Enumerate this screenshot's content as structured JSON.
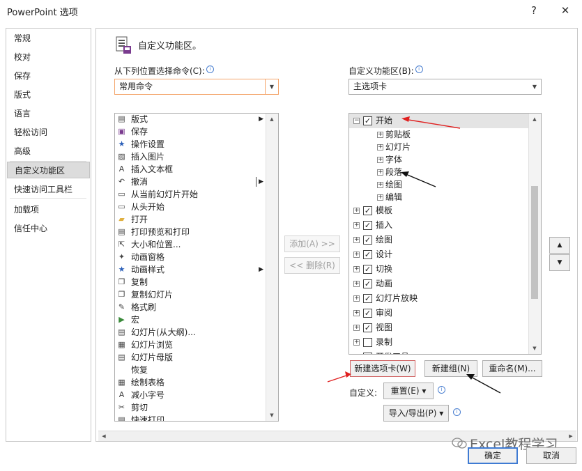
{
  "window": {
    "title": "PowerPoint 选项",
    "help_label": "?",
    "close_label": "✕"
  },
  "nav": {
    "items": [
      "常规",
      "校对",
      "保存",
      "版式",
      "语言",
      "轻松访问",
      "高级",
      "自定义功能区",
      "快速访问工具栏",
      "加载项",
      "信任中心"
    ],
    "selected_index": 7
  },
  "header": {
    "icon": "customize-ribbon-icon",
    "title": "自定义功能区。"
  },
  "left": {
    "label": "从下列位置选择命令(C):",
    "info": "ⓘ",
    "dropdown_value": "常用命令",
    "commands": [
      {
        "label": "版式",
        "icon": "layout-icon",
        "submenu": true
      },
      {
        "label": "保存",
        "icon": "save-icon"
      },
      {
        "label": "操作设置",
        "icon": "star-icon"
      },
      {
        "label": "插入图片",
        "icon": "picture-icon"
      },
      {
        "label": "插入文本框",
        "icon": "textbox-icon"
      },
      {
        "label": "撤消",
        "icon": "undo-icon",
        "submenu": true
      },
      {
        "label": "从当前幻灯片开始",
        "icon": "slideshow-icon"
      },
      {
        "label": "从头开始",
        "icon": "slideshow-start-icon"
      },
      {
        "label": "打开",
        "icon": "folder-icon"
      },
      {
        "label": "打印预览和打印",
        "icon": "print-preview-icon"
      },
      {
        "label": "大小和位置...",
        "icon": "size-icon"
      },
      {
        "label": "动画窗格",
        "icon": "animation-pane-icon"
      },
      {
        "label": "动画样式",
        "icon": "star-icon",
        "submenu": true
      },
      {
        "label": "复制",
        "icon": "copy-icon"
      },
      {
        "label": "复制幻灯片",
        "icon": "duplicate-icon"
      },
      {
        "label": "格式刷",
        "icon": "format-painter-icon"
      },
      {
        "label": "宏",
        "icon": "macro-icon"
      },
      {
        "label": "幻灯片(从大纲)...",
        "icon": "outline-icon"
      },
      {
        "label": "幻灯片浏览",
        "icon": "sorter-icon"
      },
      {
        "label": "幻灯片母版",
        "icon": "master-icon"
      },
      {
        "label": "恢复",
        "icon": ""
      },
      {
        "label": "绘制表格",
        "icon": "draw-table-icon"
      },
      {
        "label": "减小字号",
        "icon": "font-smaller-icon"
      },
      {
        "label": "剪切",
        "icon": "scissors-icon"
      },
      {
        "label": "快速打印",
        "icon": "quick-print-icon"
      }
    ]
  },
  "middle": {
    "add_label": "添加(A) >>",
    "remove_label": "<< 删除(R)"
  },
  "right": {
    "label": "自定义功能区(B):",
    "info": "ⓘ",
    "dropdown_value": "主选项卡",
    "tree": [
      {
        "label": "开始",
        "level": 0,
        "expander": "⊟",
        "checked": true,
        "highlight": true
      },
      {
        "label": "剪贴板",
        "level": 1,
        "expander": "⊞"
      },
      {
        "label": "幻灯片",
        "level": 1,
        "expander": "⊞"
      },
      {
        "label": "字体",
        "level": 1,
        "expander": "⊞"
      },
      {
        "label": "段落",
        "level": 1,
        "expander": "⊞"
      },
      {
        "label": "绘图",
        "level": 1,
        "expander": "⊞"
      },
      {
        "label": "编辑",
        "level": 1,
        "expander": "⊞"
      },
      {
        "label": "模板",
        "level": 0,
        "expander": "⊞",
        "checked": true
      },
      {
        "label": "插入",
        "level": 0,
        "expander": "⊞",
        "checked": true
      },
      {
        "label": "绘图",
        "level": 0,
        "expander": "⊞",
        "checked": true
      },
      {
        "label": "设计",
        "level": 0,
        "expander": "⊞",
        "checked": true
      },
      {
        "label": "切换",
        "level": 0,
        "expander": "⊞",
        "checked": true
      },
      {
        "label": "动画",
        "level": 0,
        "expander": "⊞",
        "checked": true
      },
      {
        "label": "幻灯片放映",
        "level": 0,
        "expander": "⊞",
        "checked": true
      },
      {
        "label": "审阅",
        "level": 0,
        "expander": "⊞",
        "checked": true
      },
      {
        "label": "视图",
        "level": 0,
        "expander": "⊞",
        "checked": true
      },
      {
        "label": "录制",
        "level": 0,
        "expander": "⊞",
        "checked": false
      },
      {
        "label": "开发工具",
        "level": 0,
        "expander": "⊞",
        "checked": false
      }
    ],
    "new_tab_label": "新建选项卡(W)",
    "new_group_label": "新建组(N)",
    "rename_label": "重命名(M)...",
    "customize_label": "自定义:",
    "reset_label": "重置(E) ▾",
    "import_export_label": "导入/导出(P) ▾",
    "move_up": "▲",
    "move_down": "▼"
  },
  "footer": {
    "ok_label": "确定",
    "cancel_label": "取消",
    "watermark": "Excel教程学习"
  },
  "colors": {
    "selected_nav": "#dcdcdc",
    "dropdown_accent": "#f4a46a",
    "annotation_red": "#e02020",
    "annotation_black": "#111111"
  }
}
